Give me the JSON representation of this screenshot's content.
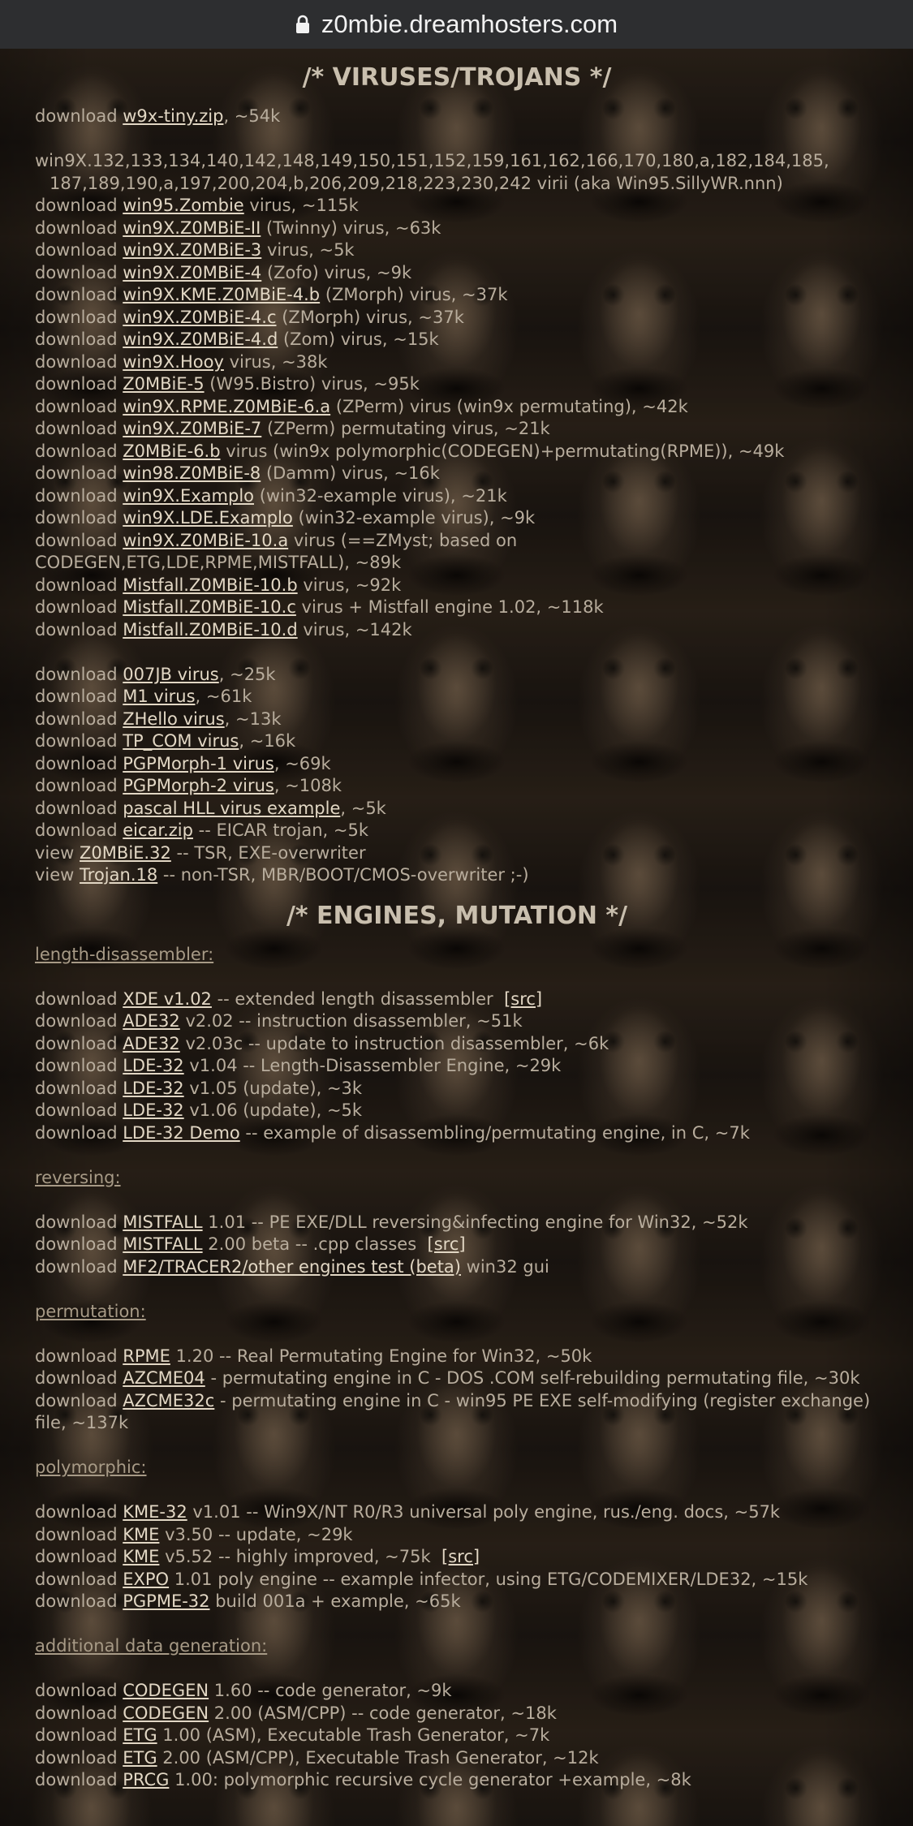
{
  "browser": {
    "host": "z0mbie.dreamhosters.com"
  },
  "viruses": {
    "heading": "/* VIRUSES/TROJANS */",
    "tiny": {
      "prefix": "download",
      "link": "w9x-tiny.zip",
      "suffix": ", ~54k"
    },
    "family_text_1": "win9X.132,133,134,140,142,148,149,150,151,152,159,161,162,166,170,180,a,182,184,185,",
    "family_text_2": "187,189,190,a,197,200,204,b,206,209,218,223,230,242 virii (aka Win95.SillyWR.nnn)",
    "items": [
      {
        "prefix": "download",
        "link": "win95.Zombie",
        "suffix": " virus, ~115k"
      },
      {
        "prefix": "download",
        "link": "win9X.Z0MBiE-II",
        "suffix": " (Twinny) virus, ~63k"
      },
      {
        "prefix": "download",
        "link": "win9X.Z0MBiE-3",
        "suffix": " virus, ~5k"
      },
      {
        "prefix": "download",
        "link": "win9X.Z0MBiE-4",
        "suffix": " (Zofo) virus, ~9k"
      },
      {
        "prefix": "download",
        "link": "win9X.KME.Z0MBiE-4.b",
        "suffix": " (ZMorph) virus, ~37k"
      },
      {
        "prefix": "download",
        "link": "win9X.Z0MBiE-4.c",
        "suffix": " (ZMorph) virus, ~37k"
      },
      {
        "prefix": "download",
        "link": "win9X.Z0MBiE-4.d",
        "suffix": " (Zom) virus, ~15k"
      },
      {
        "prefix": "download",
        "link": "win9X.Hooy",
        "suffix": " virus, ~38k"
      },
      {
        "prefix": "download",
        "link": "Z0MBiE-5",
        "suffix": " (W95.Bistro) virus, ~95k"
      },
      {
        "prefix": "download",
        "link": "win9X.RPME.Z0MBiE-6.a",
        "suffix": " (ZPerm) virus (win9x permutating), ~42k"
      },
      {
        "prefix": "download",
        "link": "win9X.Z0MBiE-7",
        "suffix": " (ZPerm) permutating virus, ~21k"
      },
      {
        "prefix": "download",
        "link": "Z0MBiE-6.b",
        "suffix": " virus (win9x polymorphic(CODEGEN)+permutating(RPME)), ~49k"
      },
      {
        "prefix": "download",
        "link": "win98.Z0MBiE-8",
        "suffix": " (Damm) virus, ~16k"
      },
      {
        "prefix": "download",
        "link": "win9X.Examplo",
        "suffix": " (win32-example virus), ~21k"
      },
      {
        "prefix": "download",
        "link": "win9X.LDE.Examplo",
        "suffix": " (win32-example virus), ~9k"
      },
      {
        "prefix": "download",
        "link": "win9X.Z0MBiE-10.a",
        "suffix": " virus (==ZMyst; based on CODEGEN,ETG,LDE,RPME,MISTFALL), ~89k"
      },
      {
        "prefix": "download",
        "link": "Mistfall.Z0MBiE-10.b",
        "suffix": " virus, ~92k"
      },
      {
        "prefix": "download",
        "link": "Mistfall.Z0MBiE-10.c",
        "suffix": " virus + Mistfall engine 1.02, ~118k"
      },
      {
        "prefix": "download",
        "link": "Mistfall.Z0MBiE-10.d",
        "suffix": " virus, ~142k"
      }
    ],
    "items2": [
      {
        "prefix": "download",
        "link": "007JB virus",
        "suffix": ", ~25k"
      },
      {
        "prefix": "download",
        "link": "M1 virus",
        "suffix": ", ~61k"
      },
      {
        "prefix": "download",
        "link": "ZHello virus",
        "suffix": ", ~13k"
      },
      {
        "prefix": "download",
        "link": "TP_COM virus",
        "suffix": ", ~16k"
      },
      {
        "prefix": "download",
        "link": "PGPMorph-1 virus",
        "suffix": ", ~69k"
      },
      {
        "prefix": "download",
        "link": "PGPMorph-2 virus",
        "suffix": ", ~108k"
      },
      {
        "prefix": "download",
        "link": "pascal HLL virus example",
        "suffix": ", ~5k"
      },
      {
        "prefix": "download",
        "link": "eicar.zip",
        "suffix": " -- EICAR trojan, ~5k"
      },
      {
        "prefix": "view",
        "link": "Z0MBiE.32",
        "suffix": " -- TSR, EXE-overwriter"
      },
      {
        "prefix": "view",
        "link": "Trojan.18",
        "suffix": " -- non-TSR, MBR/BOOT/CMOS-overwriter ;-)"
      }
    ]
  },
  "engines": {
    "heading": "/* ENGINES, MUTATION */",
    "length": {
      "title": "length-disassembler:",
      "items": [
        {
          "prefix": "download",
          "link": "XDE v1.02",
          "suffix": " -- extended length disassembler ",
          "src": "[src]"
        },
        {
          "prefix": "download",
          "link": "ADE32",
          "suffix": " v2.02 -- instruction disassembler, ~51k"
        },
        {
          "prefix": "download",
          "link": "ADE32",
          "suffix": " v2.03c -- update to instruction disassembler, ~6k"
        },
        {
          "prefix": "download",
          "link": "LDE-32",
          "suffix": " v1.04 -- Length-Disassembler Engine, ~29k"
        },
        {
          "prefix": "download",
          "link": "LDE-32",
          "suffix": " v1.05 (update), ~3k"
        },
        {
          "prefix": "download",
          "link": "LDE-32",
          "suffix": " v1.06 (update), ~5k"
        },
        {
          "prefix": "download",
          "link": "LDE-32 Demo",
          "suffix": " -- example of disassembling/permutating engine, in C, ~7k"
        }
      ]
    },
    "reversing": {
      "title": "reversing:",
      "items": [
        {
          "prefix": "download",
          "link": "MISTFALL",
          "suffix": " 1.01 -- PE EXE/DLL reversing&infecting engine for Win32, ~52k"
        },
        {
          "prefix": "download",
          "link": "MISTFALL",
          "suffix": " 2.00 beta -- .cpp classes ",
          "src": "[src]"
        },
        {
          "prefix": "download",
          "link": "MF2/TRACER2/other engines test (beta)",
          "suffix": " win32 gui"
        }
      ]
    },
    "permutation": {
      "title": "permutation:",
      "items": [
        {
          "prefix": "download",
          "link": "RPME",
          "suffix": " 1.20 -- Real Permutating Engine for Win32, ~50k"
        },
        {
          "prefix": "download",
          "link": "AZCME04",
          "suffix": " - permutating engine in C - DOS .COM self-rebuilding permutating file, ~30k"
        },
        {
          "prefix": "download",
          "link": "AZCME32c",
          "suffix": " - permutating engine in C - win95 PE EXE self-modifying (register exchange) file, ~137k"
        }
      ]
    },
    "polymorphic": {
      "title": "polymorphic:",
      "items": [
        {
          "prefix": "download",
          "link": "KME-32",
          "suffix": " v1.01 -- Win9X/NT R0/R3 universal poly engine, rus./eng. docs, ~57k"
        },
        {
          "prefix": "download",
          "link": "KME",
          "suffix": " v3.50 -- update, ~29k"
        },
        {
          "prefix": "download",
          "link": "KME",
          "suffix": " v5.52 -- highly improved, ~75k ",
          "src": "[src]"
        },
        {
          "prefix": "download",
          "link": "EXPO",
          "suffix": " 1.01 poly engine -- example infector, using ETG/CODEMIXER/LDE32, ~15k"
        },
        {
          "prefix": "download",
          "link": "PGPME-32",
          "suffix": " build 001a + example, ~65k"
        }
      ]
    },
    "datagen": {
      "title": "additional data generation:",
      "items": [
        {
          "prefix": "download",
          "link": "CODEGEN",
          "suffix": " 1.60 -- code generator, ~9k"
        },
        {
          "prefix": "download",
          "link": "CODEGEN",
          "suffix": " 2.00 (ASM/CPP) -- code generator, ~18k"
        },
        {
          "prefix": "download",
          "link": "ETG",
          "suffix": " 1.00 (ASM), Executable Trash Generator, ~7k"
        },
        {
          "prefix": "download",
          "link": "ETG",
          "suffix": " 2.00 (ASM/CPP), Executable Trash Generator, ~12k"
        },
        {
          "prefix": "download",
          "link": "PRCG",
          "suffix": " 1.00: polymorphic recursive cycle generator +example, ~8k"
        }
      ]
    }
  }
}
